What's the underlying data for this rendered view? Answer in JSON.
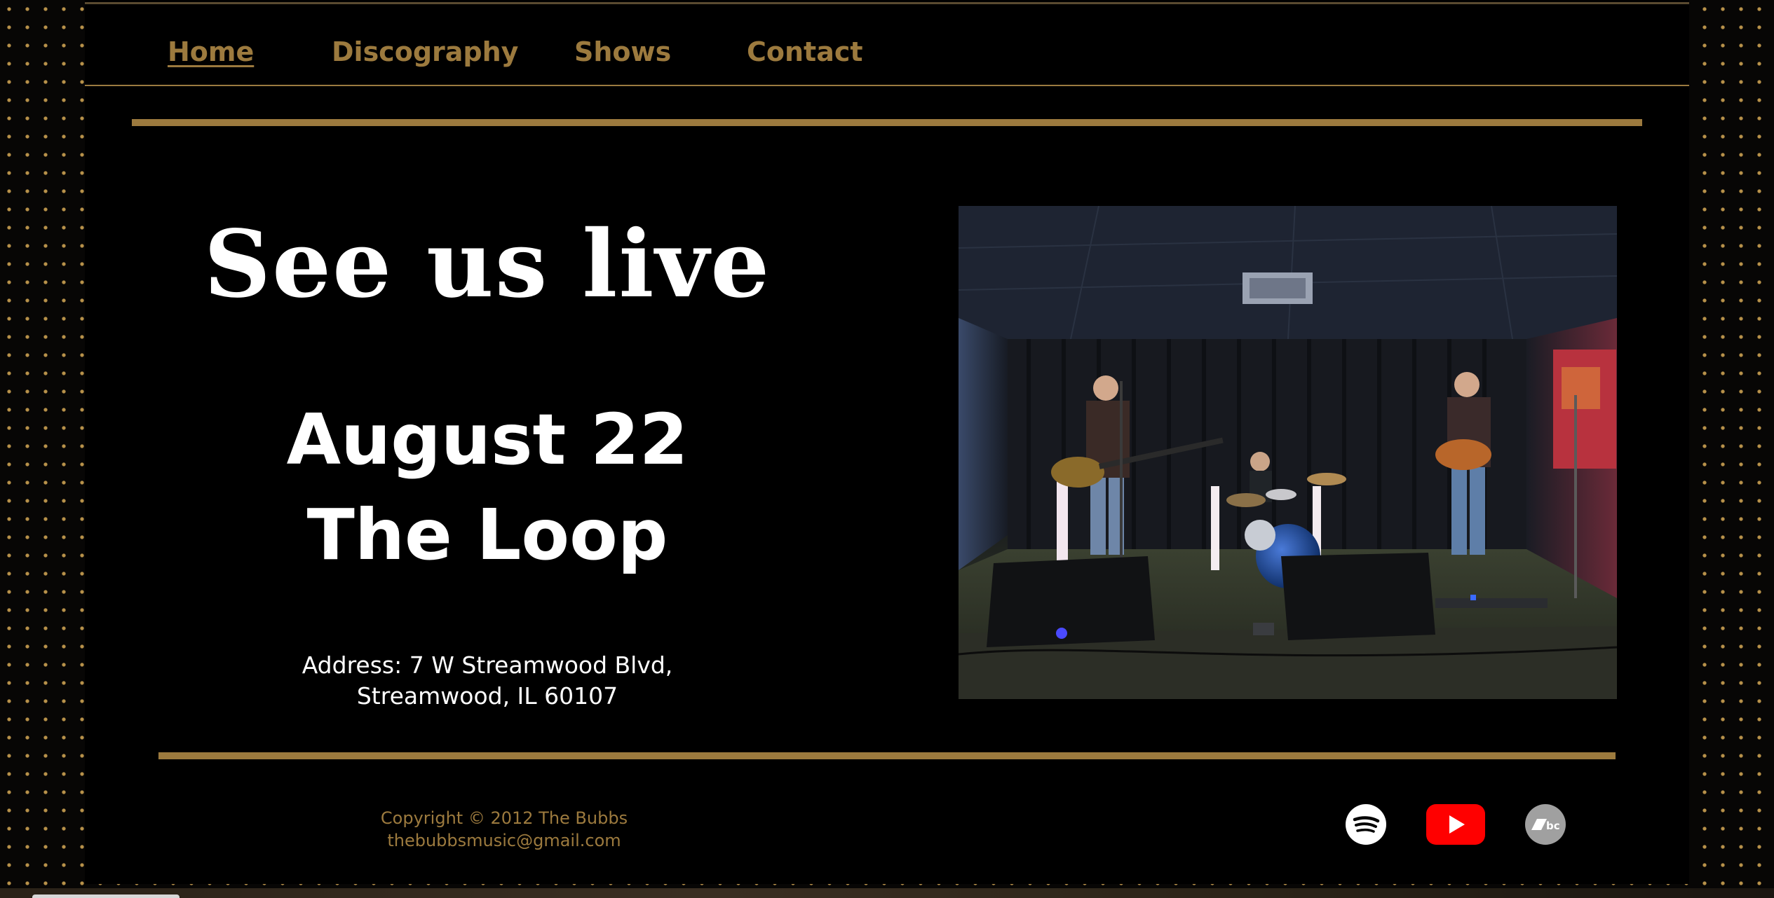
{
  "nav": {
    "items": [
      {
        "label": "Home",
        "active": true
      },
      {
        "label": "Discography",
        "active": false
      },
      {
        "label": "Shows",
        "active": false
      },
      {
        "label": "Contact",
        "active": false
      }
    ]
  },
  "hero": {
    "headline": "See us live",
    "date": "August 22",
    "venue": "The Loop",
    "address_line1": "Address: 7 W Streamwood Blvd,",
    "address_line2": "Streamwood, IL 60107"
  },
  "footer": {
    "copyright": "Copyright © 2012 The Bubbs",
    "email": "thebubbsmusic@gmail.com",
    "social": [
      {
        "name": "spotify-icon",
        "color": "#ffffff"
      },
      {
        "name": "youtube-icon",
        "color": "#ff0000"
      },
      {
        "name": "bandcamp-icon",
        "color": "#a0a0a0"
      }
    ]
  },
  "colors": {
    "accent": "#9c7a3e",
    "background": "#000000",
    "text": "#ffffff"
  }
}
